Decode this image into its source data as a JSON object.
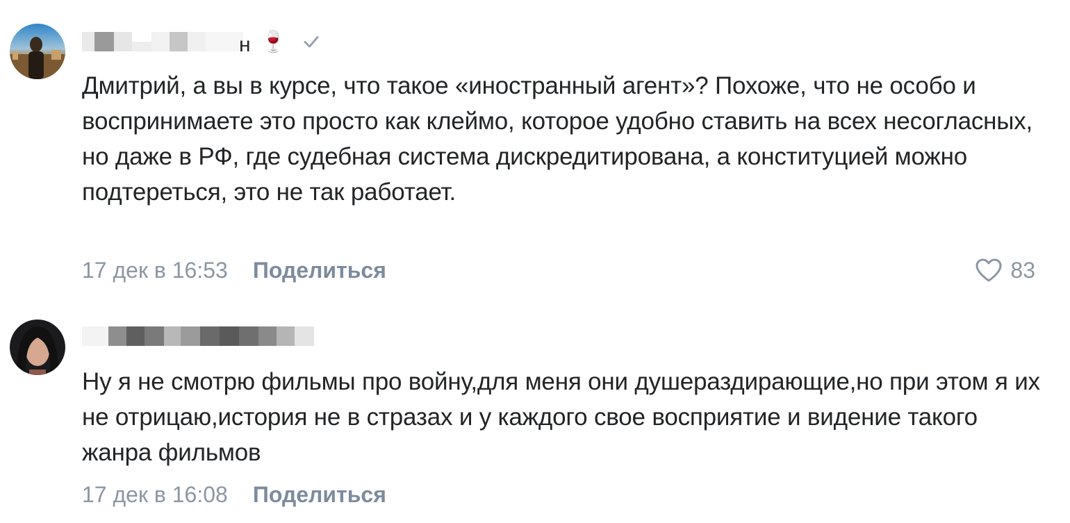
{
  "comments": [
    {
      "author_suffix": "н",
      "author_emoji": "🍷",
      "text": "Дмитрий, а вы в курсе, что такое «иностранный агент»? Похоже, что не особо и воспринимаете это просто как клеймо, которое удобно ставить на всех несогласных, но даже в РФ, где судебная система дискредитирована, а конституцией можно подтереться, это не так работает.",
      "date": "17 дек в 16:53",
      "share_label": "Поделиться",
      "likes": "83"
    },
    {
      "text": "Ну я не смотрю фильмы про войну,для меня они душераздирающие,но при этом я их не отрицаю,история не в стразах и у каждого свое восприятие и видение такого жанра фильмов",
      "date": "17 дек в 16:08",
      "share_label": "Поделиться"
    }
  ],
  "colors": {
    "text": "#222426",
    "meta": "#8c96a3",
    "share": "#7d8b9e",
    "check": "#99a2ad"
  },
  "icons": {
    "verified": "checkmark-icon",
    "like": "heart-outline-icon"
  }
}
